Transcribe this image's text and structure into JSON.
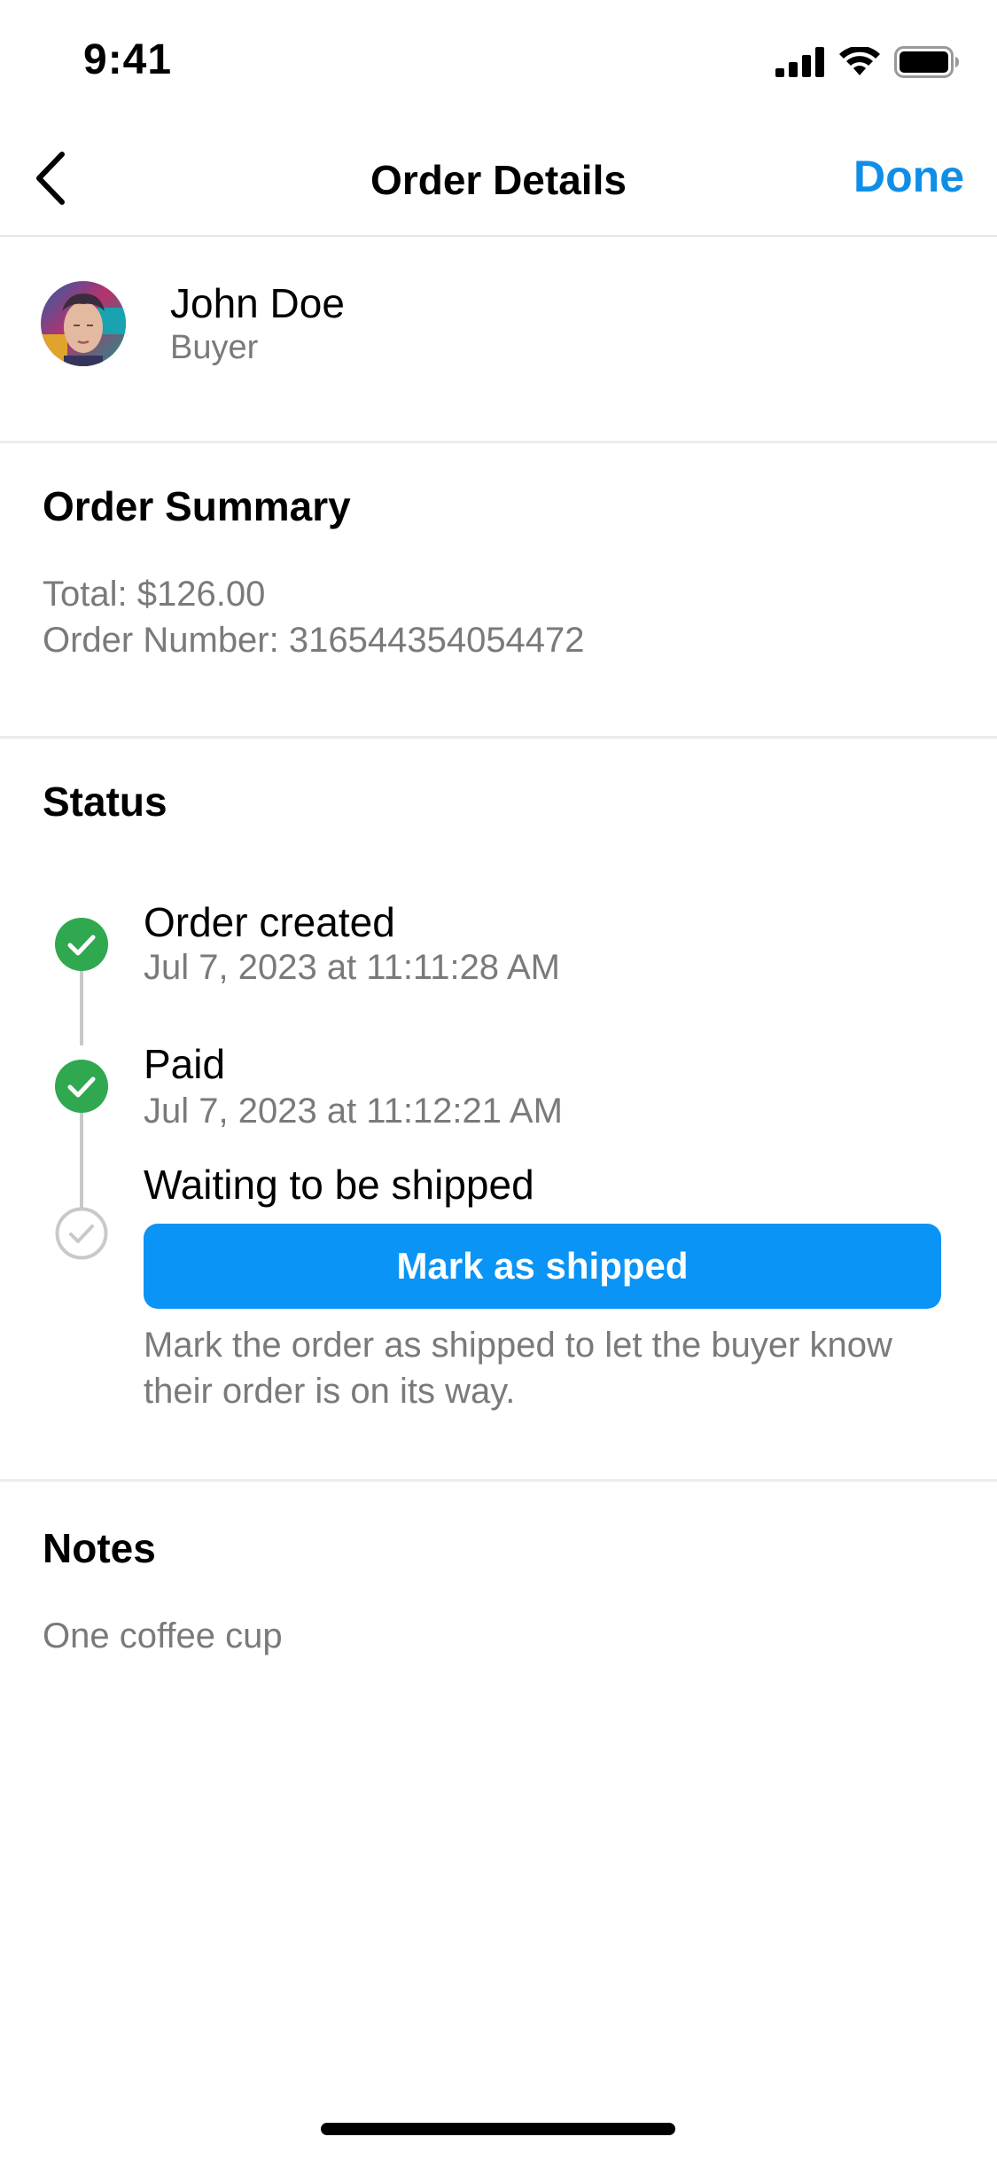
{
  "status_bar": {
    "time": "9:41"
  },
  "nav": {
    "title": "Order Details",
    "done_label": "Done",
    "back_icon": "chevron-left-icon"
  },
  "buyer": {
    "name": "John Doe",
    "role": "Buyer"
  },
  "summary": {
    "title": "Order Summary",
    "total": "Total: $126.00",
    "order_number": "Order Number: 316544354054472"
  },
  "status": {
    "title": "Status",
    "steps": [
      {
        "label": "Order created",
        "time": "Jul 7, 2023 at 11:11:28 AM",
        "state": "complete"
      },
      {
        "label": "Paid",
        "time": "Jul 7, 2023 at 11:12:21 AM",
        "state": "complete"
      },
      {
        "label": "Waiting to be shipped",
        "state": "pending"
      }
    ],
    "ship_button": "Mark as shipped",
    "ship_help": "Mark the order as shipped to let the buyer know their order is on its way."
  },
  "notes": {
    "title": "Notes",
    "text": "One coffee cup"
  },
  "colors": {
    "accent": "#0a94f5",
    "done": "#0f8ee8",
    "success": "#2fa84f",
    "muted_text": "#7a7a7a"
  }
}
